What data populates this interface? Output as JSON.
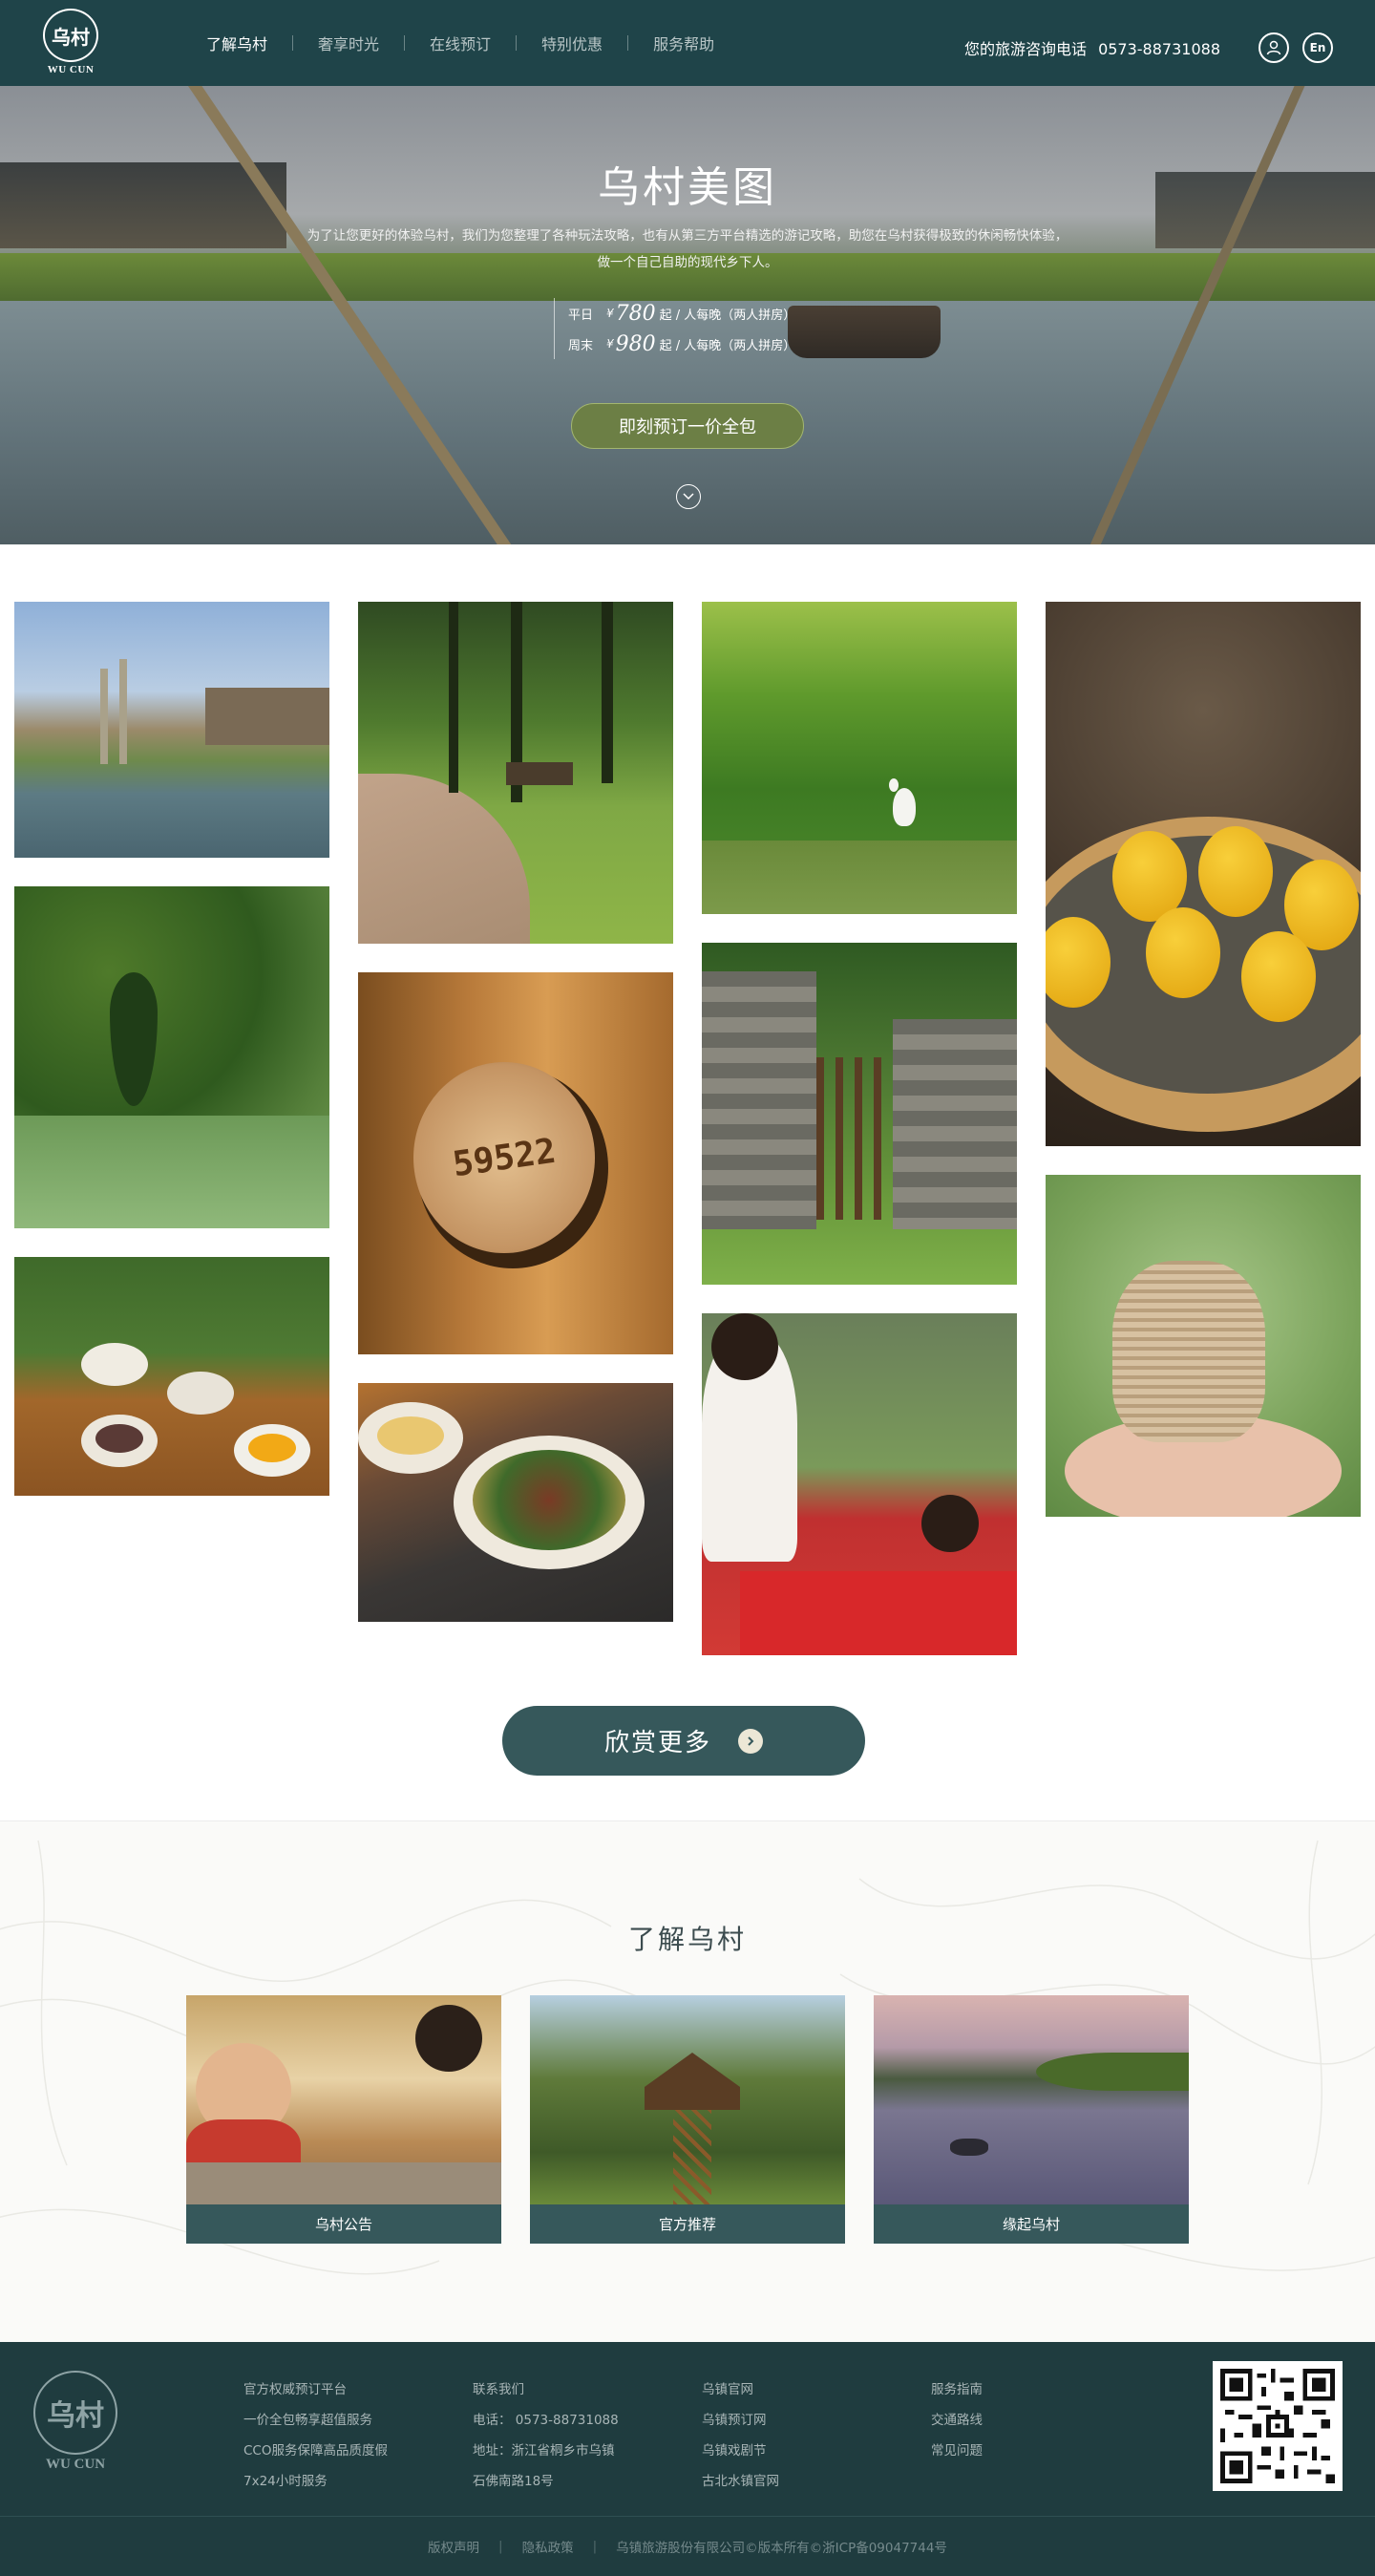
{
  "brand": {
    "logo_glyph": "乌村",
    "logo_text": "WU CUN"
  },
  "nav": {
    "items": [
      {
        "label": "了解乌村",
        "active": true
      },
      {
        "label": "奢享时光",
        "active": false
      },
      {
        "label": "在线预订",
        "active": false
      },
      {
        "label": "特别优惠",
        "active": false
      },
      {
        "label": "服务帮助",
        "active": false
      }
    ]
  },
  "header": {
    "hotline_label": "您的旅游咨询电话",
    "hotline_number": "0573-88731088",
    "user_icon": "user-icon",
    "lang_label": "En"
  },
  "hero": {
    "title": "乌村美图",
    "desc_line1": "为了让您更好的体验乌村，我们为您整理了各种玩法攻略，也有从第三方平台精选的游记攻略，助您在乌村获得极致的休闲畅快体验，",
    "desc_line2": "做一个自己自助的现代乡下人。",
    "weekday_label": "平日",
    "weekday_currency": "¥",
    "weekday_price": "780",
    "weekday_suffix": "起 / 人每晚（两人拼房）",
    "weekend_label": "周末",
    "weekend_currency": "¥",
    "weekend_price": "980",
    "weekend_suffix": "起 / 人每晚（两人拼房）",
    "book_button": "即刻预订一价全包",
    "scroll_icon": "chevron-down-icon"
  },
  "gallery": {
    "more_button": "欣赏更多",
    "more_icon": "arrow-right-icon",
    "number_plate": "59522"
  },
  "about": {
    "title": "了解乌村",
    "cards": [
      {
        "label": "乌村公告"
      },
      {
        "label": "官方推荐"
      },
      {
        "label": "缘起乌村"
      }
    ]
  },
  "footer": {
    "col1": [
      "官方权威预订平台",
      "一价全包畅享超值服务",
      "CCO服务保障高品质度假",
      "7x24小时服务"
    ],
    "col2": [
      "联系我们",
      "电话： 0573-88731088",
      "地址：浙江省桐乡市乌镇",
      "石佛南路18号"
    ],
    "col3": [
      "乌镇官网",
      "乌镇预订网",
      "乌镇戏剧节",
      "古北水镇官网"
    ],
    "col4": [
      "服务指南",
      "交通路线",
      "常见问题"
    ],
    "bottom": [
      "版权声明",
      "隐私政策",
      "乌镇旅游股份有限公司©版本所有©浙ICP备09047744号"
    ]
  },
  "colors": {
    "primary": "#1f4449",
    "accent_button": "#36585b",
    "book_button": "#6c7f45",
    "footer_bg": "#1f3c3f"
  }
}
